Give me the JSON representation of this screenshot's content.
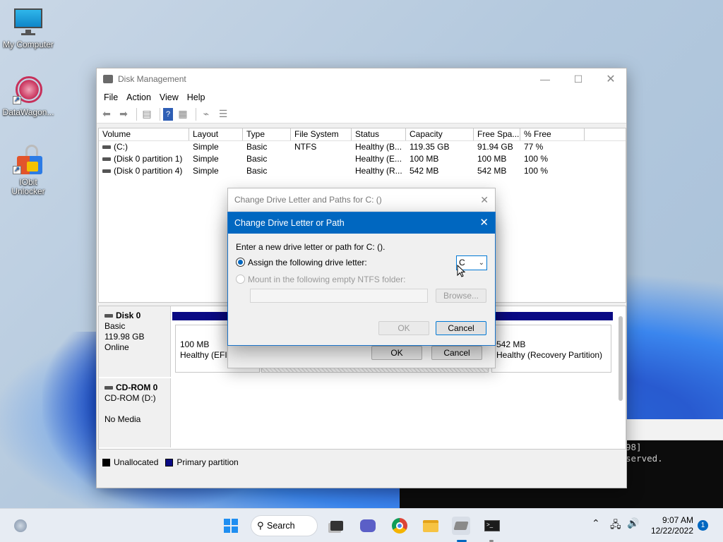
{
  "desktop": {
    "icons": [
      {
        "label": "My Computer"
      },
      {
        "label": "DataWagon..."
      },
      {
        "label": "IObit\nUnlocker"
      }
    ]
  },
  "terminal": {
    "lines": [
      "98]",
      "served."
    ]
  },
  "disk_mgmt": {
    "title": "Disk Management",
    "menu": [
      "File",
      "Action",
      "View",
      "Help"
    ],
    "columns": [
      "Volume",
      "Layout",
      "Type",
      "File System",
      "Status",
      "Capacity",
      "Free Spa...",
      "% Free"
    ],
    "rows": [
      [
        "(C:)",
        "Simple",
        "Basic",
        "NTFS",
        "Healthy (B...",
        "119.35 GB",
        "91.94 GB",
        "77 %"
      ],
      [
        "(Disk 0 partition 1)",
        "Simple",
        "Basic",
        "",
        "Healthy (E...",
        "100 MB",
        "100 MB",
        "100 %"
      ],
      [
        "(Disk 0 partition 4)",
        "Simple",
        "Basic",
        "",
        "Healthy (R...",
        "542 MB",
        "542 MB",
        "100 %"
      ]
    ],
    "disk0": {
      "name": "Disk 0",
      "type": "Basic",
      "size": "119.98 GB",
      "state": "Online"
    },
    "disk0_p1": {
      "size": "100 MB",
      "status": "Healthy (EFI S"
    },
    "disk0_p4": {
      "size": "542 MB",
      "status": "Healthy (Recovery Partition)"
    },
    "cdrom": {
      "name": "CD-ROM 0",
      "type": "CD-ROM (D:)",
      "media": "No Media"
    },
    "legend": {
      "unallocated": "Unallocated",
      "primary": "Primary partition"
    }
  },
  "dialog_back": {
    "title": "Change Drive Letter and Paths for C: ()",
    "ok": "OK",
    "cancel": "Cancel"
  },
  "dialog": {
    "title": "Change Drive Letter or Path",
    "prompt": "Enter a new drive letter or path for C: ().",
    "assign_label": "Assign the following drive letter:",
    "drive_letter": "C",
    "mount_label": "Mount in the following empty NTFS folder:",
    "browse": "Browse...",
    "ok": "OK",
    "cancel": "Cancel"
  },
  "taskbar": {
    "search_label": "Search",
    "time": "9:07 AM",
    "date": "12/22/2022",
    "notifications": "1"
  },
  "colors": {
    "primary_partition": "#0a0a84",
    "dialog_title": "#0067c0"
  }
}
